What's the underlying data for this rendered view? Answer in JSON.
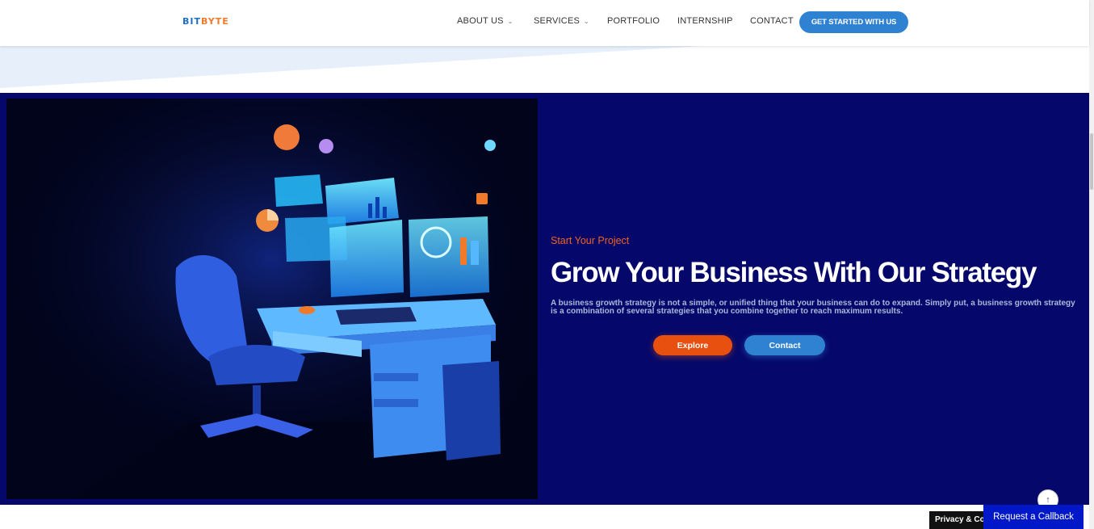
{
  "header": {
    "logo_part1": "BIT",
    "logo_part2": "BYTE",
    "nav": [
      {
        "label": "ABOUT US"
      },
      {
        "label": "SERVICES"
      },
      {
        "label": "PORTFOLIO"
      },
      {
        "label": "INTERNSHIP"
      },
      {
        "label": "CONTACT"
      }
    ],
    "cta_label": "GET STARTED WITH US"
  },
  "hero": {
    "subtitle": "Start Your Project",
    "title": "Grow Your Business With Our Strategy",
    "description": "A business growth strategy is not a simple, or unified thing that your business can do to expand. Simply put, a business growth strategy is a combination of several strategies that you combine together to reach maximum results.",
    "explore_label": "Explore",
    "contact_label": "Contact"
  },
  "widgets": {
    "back_to_top": "↑",
    "privacy_label": "Privacy & Cookies",
    "callback_label": "Request a Callback"
  },
  "colors": {
    "hero_bg": "#05086a",
    "accent_orange": "#e8500f",
    "accent_blue": "#2f82d1"
  }
}
